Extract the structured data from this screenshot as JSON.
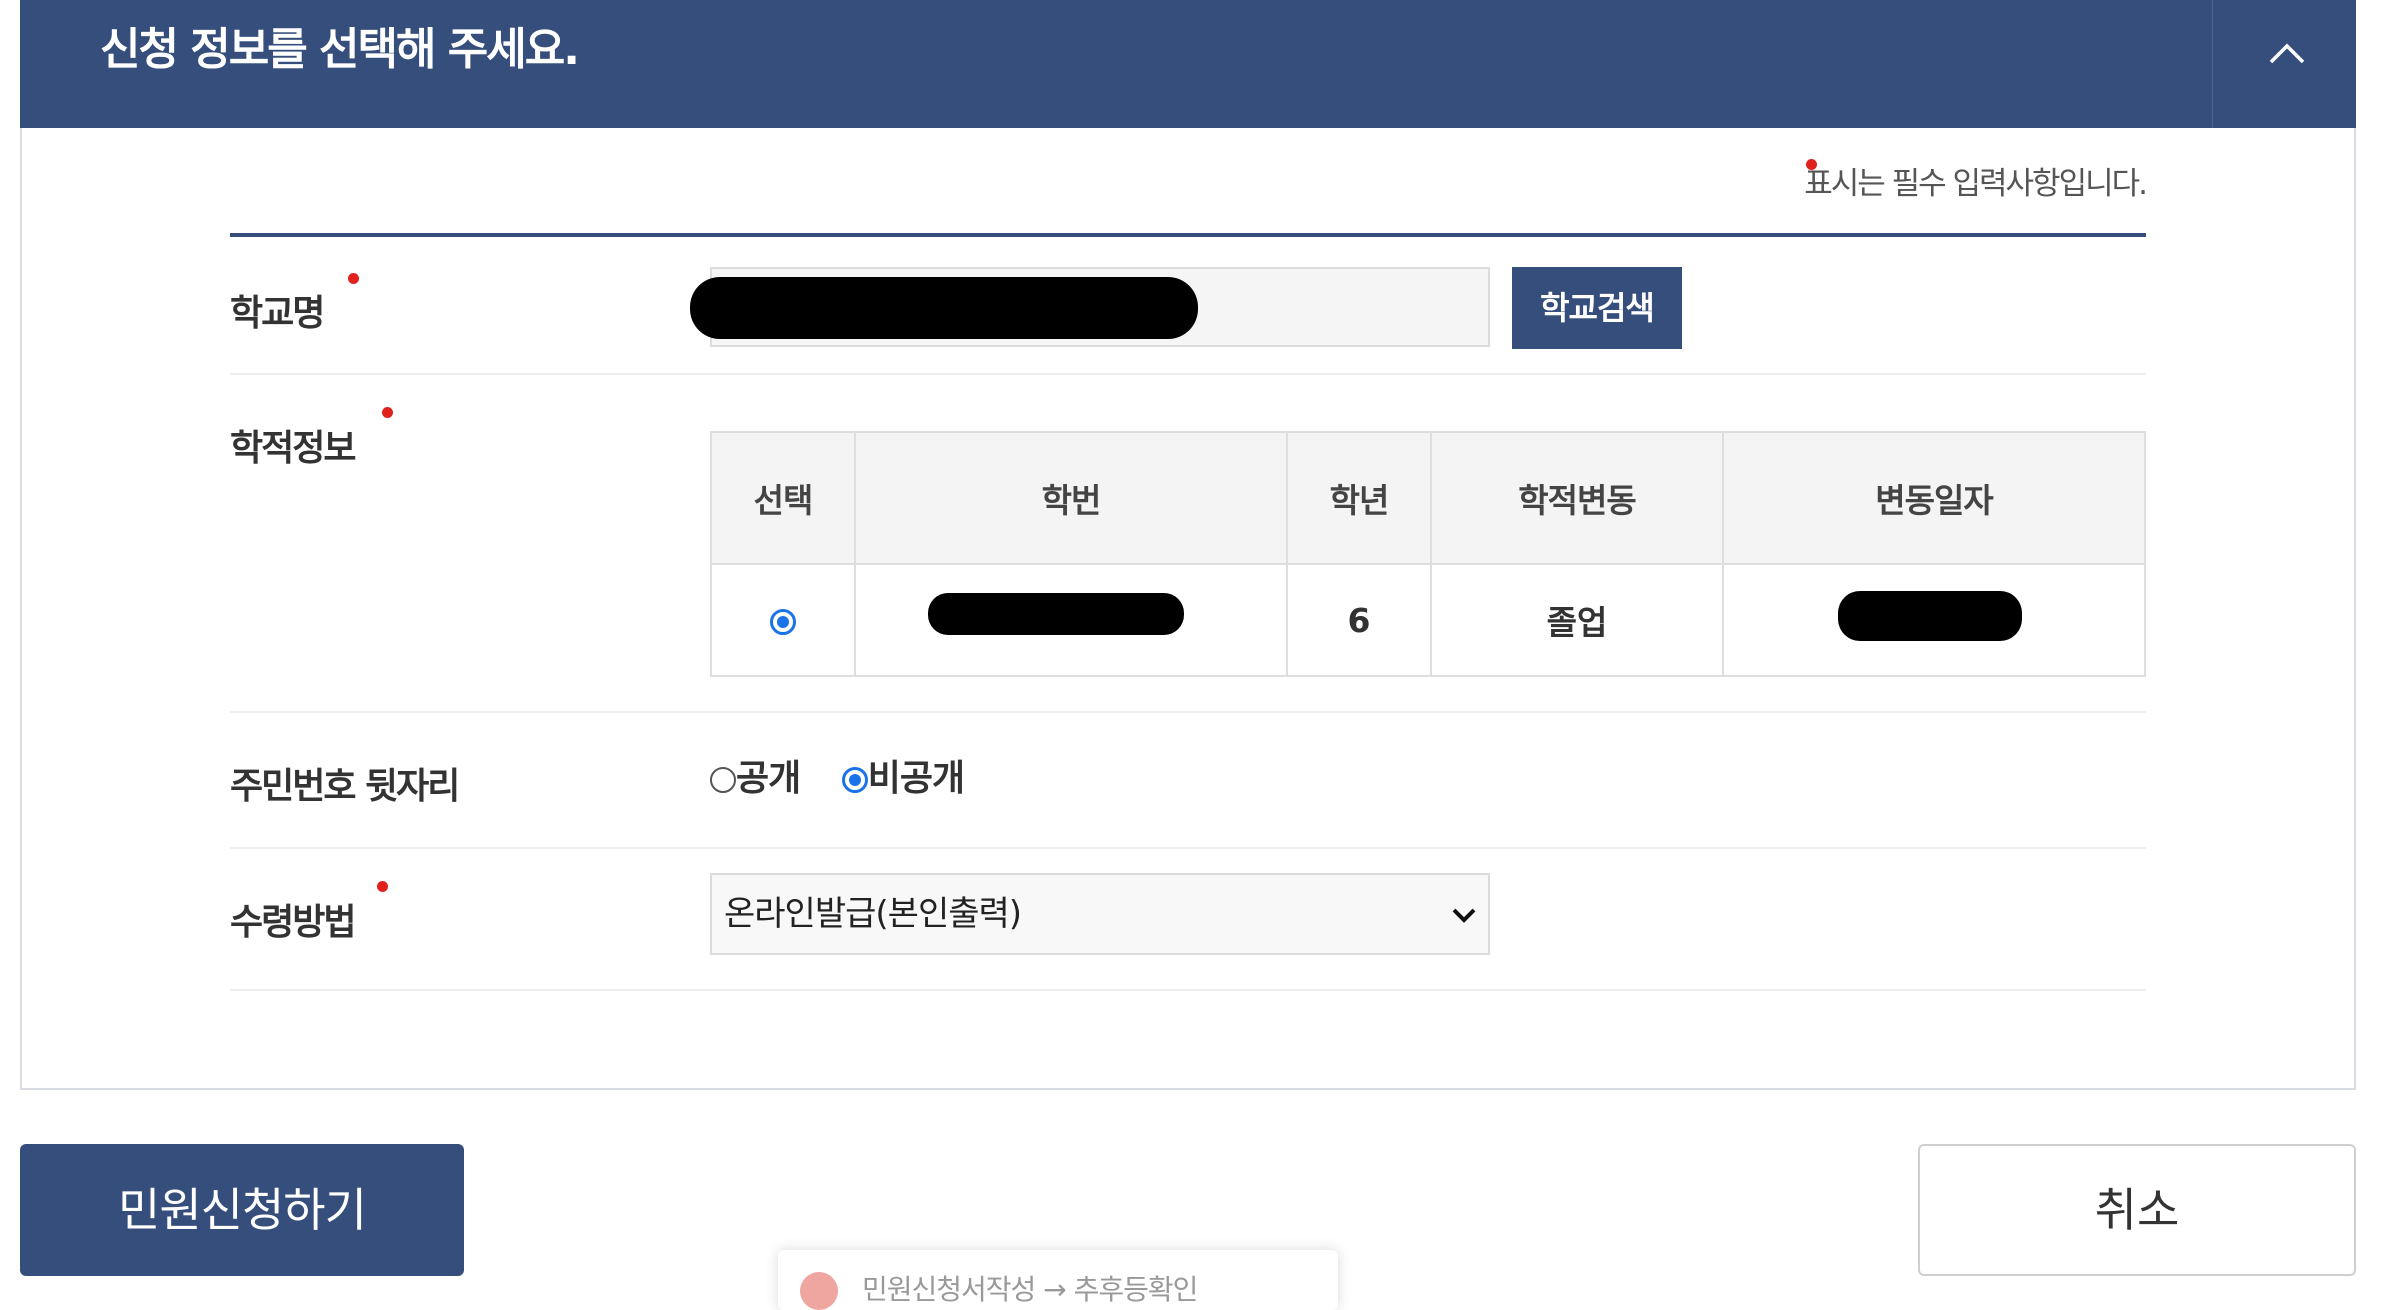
{
  "header": {
    "title": "신청 정보를 선택해 주세요."
  },
  "required_note": "표시는 필수 입력사항입니다.",
  "form": {
    "school_name": {
      "label": "학교명",
      "search_button": "학교검색"
    },
    "academic_info": {
      "label": "학적정보",
      "columns": [
        "선택",
        "학번",
        "학년",
        "학적변동",
        "변동일자"
      ],
      "rows": [
        {
          "selected": true,
          "student_id": "",
          "grade": "6",
          "status": "졸업",
          "change_date": ""
        }
      ]
    },
    "resident_number": {
      "label": "주민번호 뒷자리",
      "options": [
        "공개",
        "비공개"
      ],
      "selected": "비공개"
    },
    "receipt_method": {
      "label": "수령방법",
      "value": "온라인발급(본인출력)"
    }
  },
  "actions": {
    "submit": "민원신청하기",
    "cancel": "취소"
  },
  "toast": {
    "text": "민원신청서작성 → 추후등확인"
  },
  "colors": {
    "primary": "#354e7c",
    "required_dot": "#e0211d",
    "radio_checked": "#1a73e8"
  }
}
